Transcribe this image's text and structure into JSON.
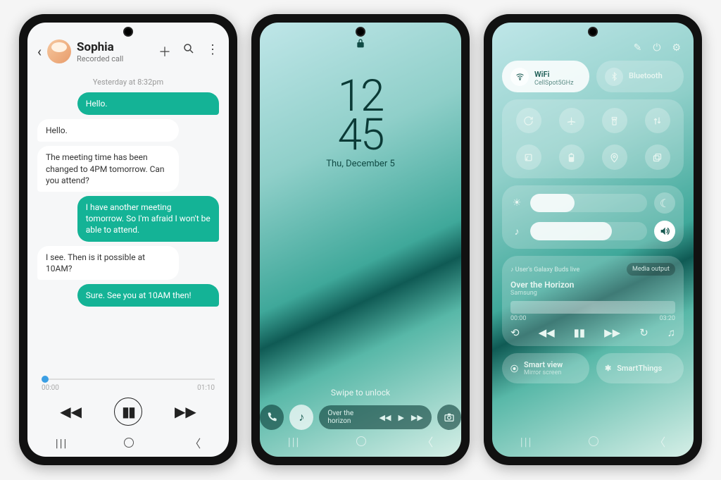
{
  "phone1": {
    "contact_name": "Sophia",
    "subtitle": "Recorded call",
    "timestamp": "Yesterday at 8:32pm",
    "messages": [
      {
        "dir": "out",
        "text": "Hello."
      },
      {
        "dir": "in",
        "text": "Hello."
      },
      {
        "dir": "in",
        "text": "The meeting time has been changed to 4PM tomorrow. Can you attend?"
      },
      {
        "dir": "out",
        "text": "I have another meeting tomorrow. So I'm afraid I won't be able to attend."
      },
      {
        "dir": "in",
        "text": "I see. Then is it possible at 10AM?"
      },
      {
        "dir": "out",
        "text": "Sure. See you at 10AM then!"
      }
    ],
    "player": {
      "start": "00:00",
      "end": "01:10"
    }
  },
  "phone2": {
    "time_top": "12",
    "time_bot": "45",
    "date": "Thu, December 5",
    "swipe": "Swipe to unlock",
    "media_title": "Over the horizon"
  },
  "phone3": {
    "wifi": {
      "label": "WiFi",
      "sub": "CellSpot5GHz"
    },
    "bt": {
      "label": "Bluetooth"
    },
    "brightness_pct": 38,
    "volume_pct": 70,
    "media": {
      "device": "User's Galaxy Buds live",
      "output": "Media output",
      "title": "Over the Horizon",
      "artist": "Samsung",
      "t0": "00:00",
      "t1": "03:20"
    },
    "smartview": {
      "label": "Smart view",
      "sub": "Mirror screen"
    },
    "smartthings": "SmartThings"
  }
}
